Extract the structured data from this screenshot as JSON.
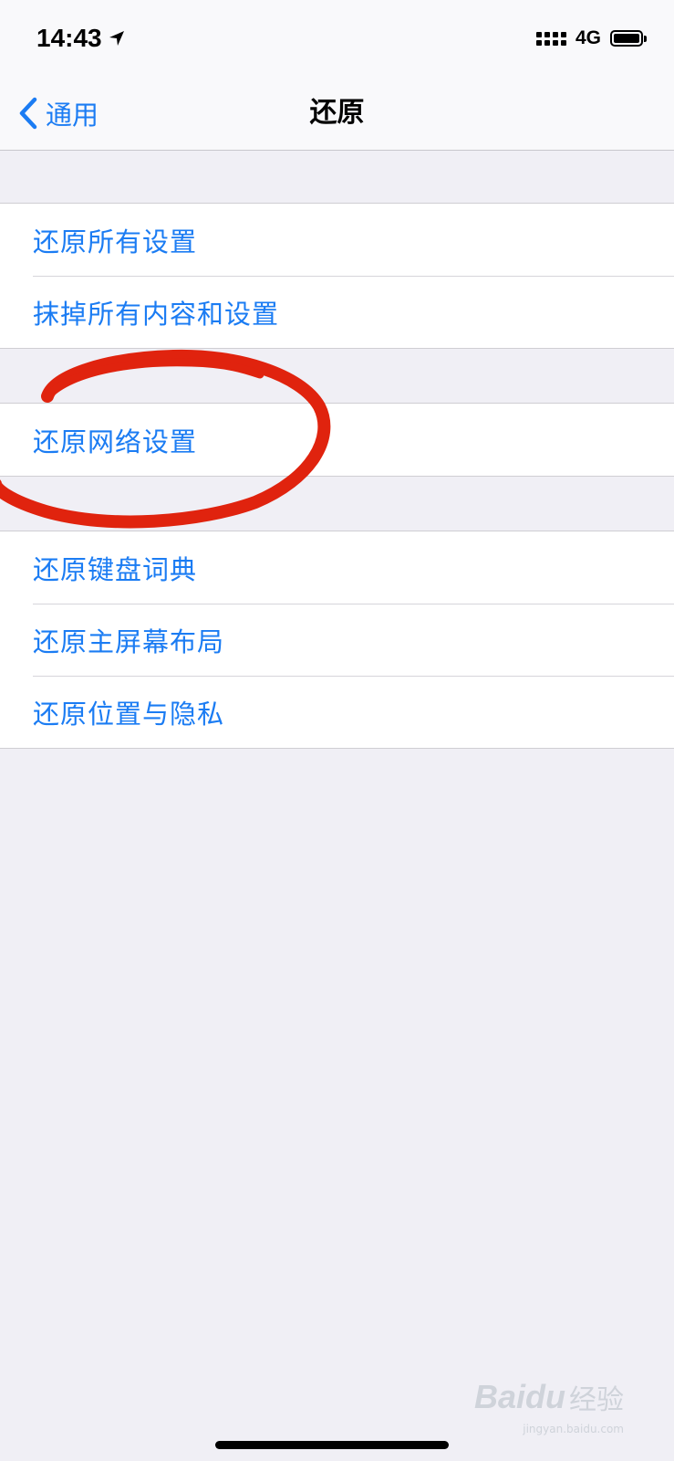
{
  "status_bar": {
    "time": "14:43",
    "network": "4G",
    "location_icon": "location-arrow-icon",
    "signal_icon": "cellular-signal-icon",
    "battery_icon": "battery-icon",
    "battery_level": 1.0
  },
  "nav": {
    "back_label": "通用",
    "back_icon": "chevron-left-icon",
    "title": "还原"
  },
  "groups": [
    {
      "items": [
        "还原所有设置",
        "抹掉所有内容和设置"
      ]
    },
    {
      "items": [
        "还原网络设置"
      ]
    },
    {
      "items": [
        "还原键盘词典",
        "还原主屏幕布局",
        "还原位置与隐私"
      ]
    }
  ],
  "annotation": {
    "shape": "hand-drawn-circle",
    "color": "#e0230e",
    "target": "还原网络设置"
  },
  "watermark": {
    "logo": "Baidu",
    "text": "经验",
    "url": "jingyan.baidu.com"
  },
  "colors": {
    "accent": "#1b7cf3",
    "background": "#f0eff5",
    "cell": "#ffffff",
    "annotation": "#e0230e"
  }
}
